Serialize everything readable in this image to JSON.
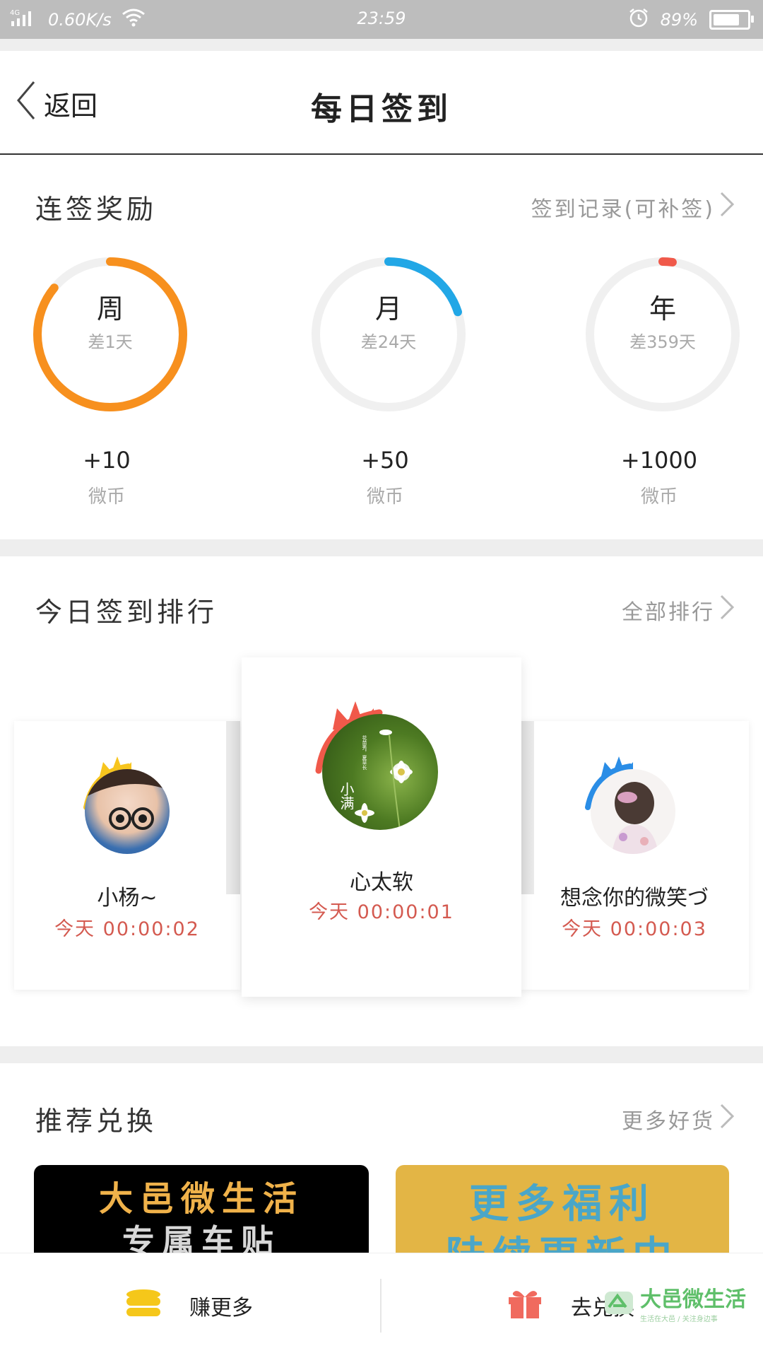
{
  "statusbar": {
    "network": "4G",
    "speed": "0.60K/s",
    "time": "23:59",
    "battery": "89%",
    "battery_level": 0.89
  },
  "header": {
    "back_label": "返回",
    "title": "每日签到"
  },
  "streak": {
    "title": "连签奖励",
    "link": "签到记录(可补签)",
    "rings": [
      {
        "label": "周",
        "remaining": "差1天",
        "progress": 0.86,
        "color": "#f7901e",
        "reward": "+10",
        "unit": "微币"
      },
      {
        "label": "月",
        "remaining": "差24天",
        "progress": 0.2,
        "color": "#22a7e6",
        "reward": "+50",
        "unit": "微币"
      },
      {
        "label": "年",
        "remaining": "差359天",
        "progress": 0.02,
        "color": "#f0594a",
        "reward": "+1000",
        "unit": "微币"
      }
    ]
  },
  "ranking": {
    "title": "今日签到排行",
    "link": "全部排行",
    "entries": [
      {
        "rank": 2,
        "name": "小杨~",
        "time": "今天 00:00:02",
        "crown_color": "#f7c51e"
      },
      {
        "rank": 1,
        "name": "心太软",
        "time": "今天 00:00:01",
        "crown_color": "#f0594a",
        "avatar_text_main": "小满",
        "avatar_text_side": "花苗秀，夏草长"
      },
      {
        "rank": 3,
        "name": "想念你的微笑づ",
        "time": "今天 00:00:03",
        "crown_color": "#2a8de6"
      }
    ]
  },
  "exchange": {
    "title": "推荐兑换",
    "link": "更多好货",
    "banners": [
      {
        "line1": "大邑微生活",
        "line2": "专属车贴",
        "bg": "#000000"
      },
      {
        "line1": "更多福利",
        "line2": "陆续更新中",
        "bg": "#e3b545"
      }
    ]
  },
  "bottombar": {
    "earn_label": "赚更多",
    "redeem_label": "去兑换"
  },
  "watermark": {
    "brand": "大邑微生活",
    "tagline": "生活在大邑 / 关注身边事"
  }
}
